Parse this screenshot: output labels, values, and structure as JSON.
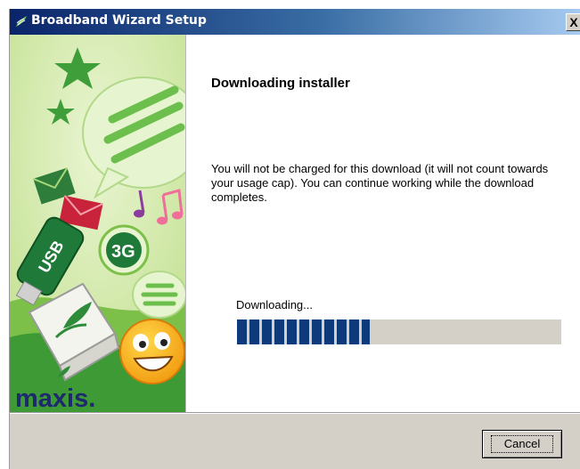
{
  "window": {
    "title": "Broadband Wizard Setup",
    "close_label": "X"
  },
  "banner": {
    "brand": "maxis.",
    "usb_label": "USB",
    "network_label": "3G"
  },
  "content": {
    "heading": "Downloading installer",
    "description": "You will not be charged for this download (it will not count towards your usage cap). You can continue working while the download completes.",
    "progress_label": "Downloading...",
    "progress_fraction": 0.41
  },
  "footer": {
    "cancel_label": "Cancel"
  },
  "colors": {
    "titlebar_start": "#0a246a",
    "titlebar_end": "#a6caf0",
    "progress_fill": "#0c3a7a",
    "dialog_bg": "#d4d0c8",
    "brand_green": "#2e8b3a"
  }
}
